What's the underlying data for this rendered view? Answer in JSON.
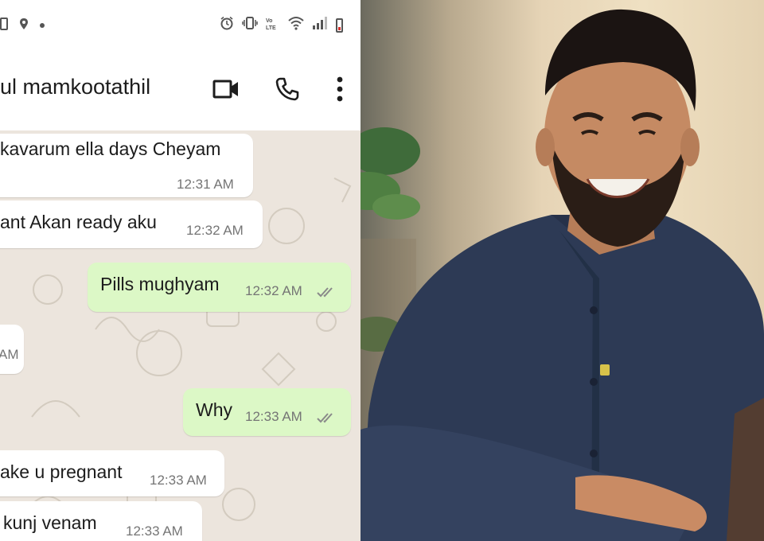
{
  "chat": {
    "contact_name": "ul mamkootathil",
    "messages": [
      {
        "direction": "in",
        "text": "kavarum ella days Cheyam",
        "time": "12:31 AM"
      },
      {
        "direction": "in",
        "text": "ant Akan ready aku",
        "time": "12:32 AM"
      },
      {
        "direction": "out",
        "text": "Pills mughyam",
        "time": "12:32 AM"
      },
      {
        "direction": "in",
        "text": "",
        "time": "AM"
      },
      {
        "direction": "out",
        "text": "Why",
        "time": "12:33 AM"
      },
      {
        "direction": "in",
        "text": "ake u pregnant",
        "time": "12:33 AM"
      },
      {
        "direction": "in",
        "text": "kunj venam",
        "time": "12:33 AM"
      }
    ],
    "icons": {
      "video_call": "video-camera-icon",
      "voice_call": "phone-icon",
      "menu": "more-vertical-icon",
      "read_receipt": "double-check-icon"
    },
    "colors": {
      "incoming_bubble": "#ffffff",
      "outgoing_bubble": "#dcf8c6",
      "chat_background": "#ece5dd",
      "battery_low": "#d9302c"
    }
  },
  "status_bar": {
    "icons": [
      "sim-icon",
      "location-icon",
      "notification-dot-icon",
      "alarm-icon",
      "vibrate-icon",
      "volte-icon",
      "wifi-icon",
      "signal-icon",
      "battery-low-icon"
    ]
  },
  "photo": {
    "subject": "smiling-man-portrait"
  }
}
